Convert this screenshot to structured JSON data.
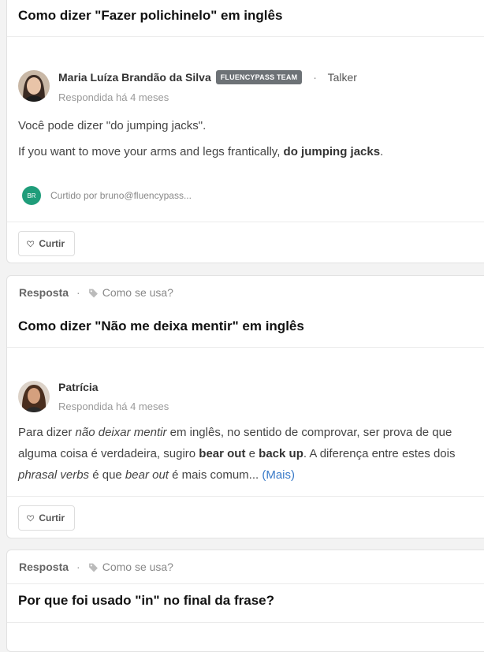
{
  "card1": {
    "title": "Como dizer \"Fazer polichinelo\" em inglês",
    "author": {
      "name": "Maria Luíza Brandão da Silva",
      "badge": "FLUENCYPASS TEAM",
      "separator": "·",
      "role": "Talker",
      "answered": "Respondida há 4 meses"
    },
    "paragraph1": "Você pode dizer \"do jumping jacks\".",
    "paragraph2_pre": "If you want to move your arms and legs frantically, ",
    "paragraph2_bold": "do jumping jacks",
    "paragraph2_post": ".",
    "liked": {
      "initials": "BR",
      "text": "Curtido por bruno@fluencypass..."
    },
    "like_label": "Curtir"
  },
  "card2": {
    "kind": "Resposta",
    "separator": "·",
    "tag": "Como se usa?",
    "title": "Como dizer \"Não me deixa mentir\" em inglês",
    "author": {
      "name": "Patrícia",
      "answered": "Respondida há 4 meses"
    },
    "body": {
      "t1": "Para dizer ",
      "i1": "não deixar mentir",
      "t2": " em inglês, no sentido de comprovar, ser prova de que alguma coisa é verdadeira, sugiro ",
      "b1": "bear out",
      "t3": " e ",
      "b2": "back up",
      "t4": ". A diferença entre estes dois ",
      "i2": "phrasal verbs",
      "t5": " é que ",
      "i3": "bear out",
      "t6": " é mais comum... ",
      "more": "(Mais)"
    },
    "like_label": "Curtir"
  },
  "card3": {
    "kind": "Resposta",
    "separator": "·",
    "tag": "Como se usa?",
    "title": "Por que foi usado \"in\" no final da frase?"
  },
  "colors": {
    "badge": "#6d7276",
    "link": "#3a7bc8",
    "liked_avatar": "#1f9d7a"
  },
  "icons": {
    "tag": "tag-icon",
    "heart": "heart-icon"
  }
}
